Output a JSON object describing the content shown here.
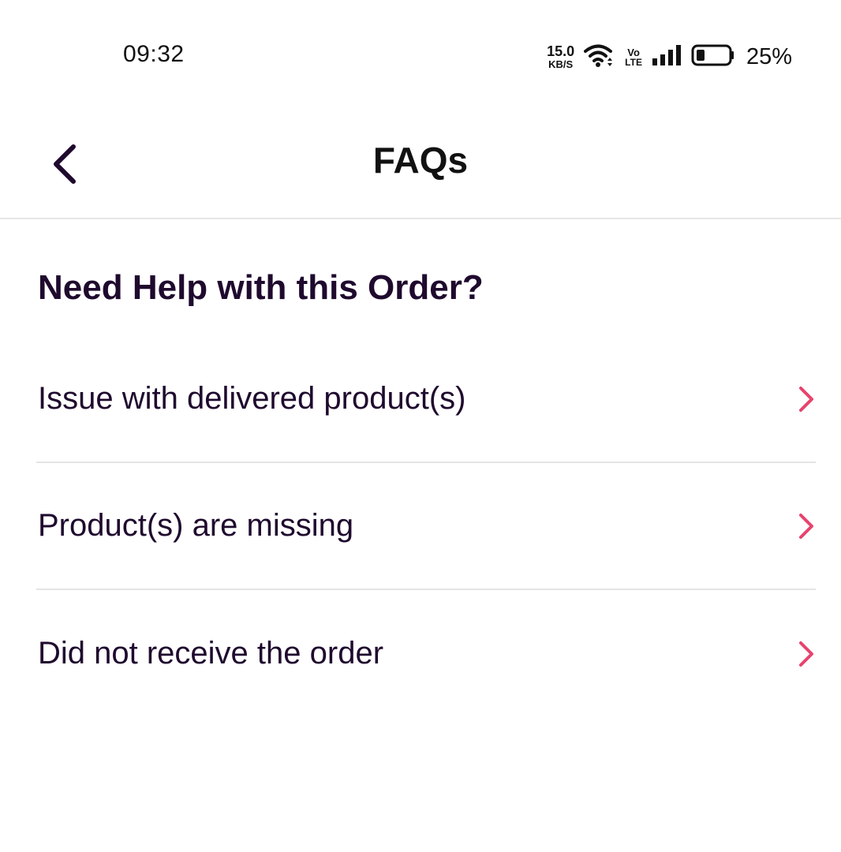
{
  "status_bar": {
    "time": "09:32",
    "net_speed_value": "15.0",
    "net_speed_unit": "KB/S",
    "volte_top": "Vo",
    "volte_bottom": "LTE",
    "battery_percent": "25%"
  },
  "header": {
    "title": "FAQs",
    "back_icon": "chevron-left-icon"
  },
  "section": {
    "title": "Need Help with this Order?"
  },
  "faq_items": [
    {
      "label": "Issue with delivered product(s)",
      "icon": "chevron-right-icon"
    },
    {
      "label": "Product(s) are missing",
      "icon": "chevron-right-icon"
    },
    {
      "label": "Did not receive the order",
      "icon": "chevron-right-icon"
    }
  ],
  "colors": {
    "text_primary": "#1f0a2e",
    "accent": "#e8436e",
    "divider": "#e4e4e4"
  }
}
